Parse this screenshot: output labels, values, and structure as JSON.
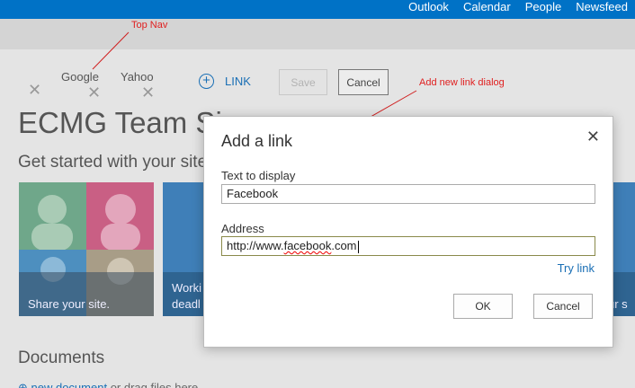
{
  "suite_bar": {
    "links": [
      "Outlook",
      "Calendar",
      "People",
      "Newsfeed"
    ]
  },
  "top_nav": {
    "items": [
      "Google",
      "Yahoo"
    ],
    "link_label": "LINK",
    "save_label": "Save",
    "cancel_label": "Cancel"
  },
  "page": {
    "site_title": "ECMG Team Si",
    "get_started": "Get started with your site",
    "tiles": [
      {
        "label": "Share your site."
      },
      {
        "label": "Worki"
      },
      {
        "label": "deadl"
      },
      {
        "label": "ur s"
      }
    ],
    "documents_heading": "Documents",
    "new_document_link": "new document",
    "drag_text": " or drag files here"
  },
  "annotations": {
    "top_nav": "Top Nav",
    "dialog": "Add new link dialog"
  },
  "dialog": {
    "title": "Add a link",
    "close_glyph": "✕",
    "text_label": "Text to display",
    "text_value": "Facebook",
    "address_label": "Address",
    "address_prefix": "http://www.",
    "address_spell": "facebook",
    "address_suffix": ".com",
    "try_link": "Try link",
    "ok_label": "OK",
    "cancel_label": "Cancel"
  },
  "colors": {
    "suite_bar": "#0072c6",
    "accent": "#1a6fb5",
    "annotation": "#e02020"
  }
}
